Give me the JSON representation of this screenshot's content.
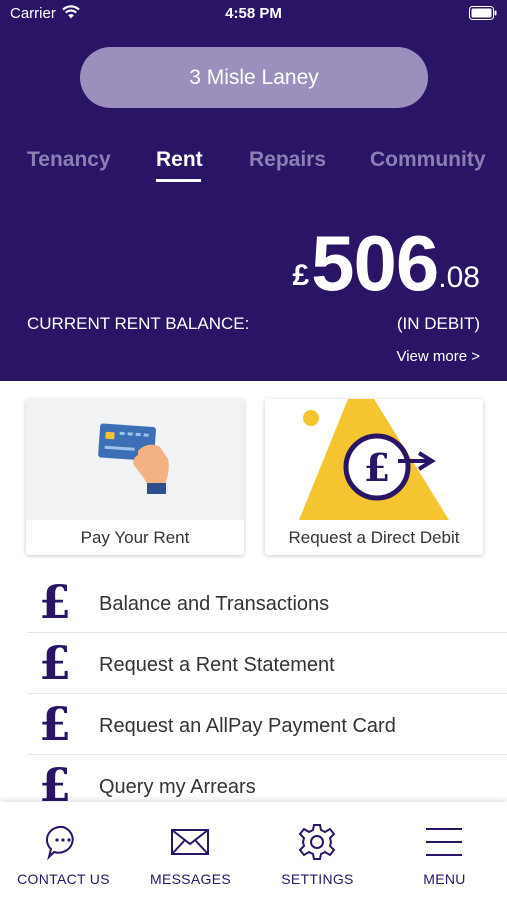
{
  "status_bar": {
    "carrier": "Carrier",
    "time": "4:58 PM"
  },
  "property": {
    "address": "3 Misle Laney"
  },
  "tabs": [
    {
      "label": "Tenancy",
      "active": false
    },
    {
      "label": "Rent",
      "active": true
    },
    {
      "label": "Repairs",
      "active": false
    },
    {
      "label": "Community",
      "active": false
    }
  ],
  "balance": {
    "currency": "£",
    "amount_main": "506",
    "amount_pence": ".08",
    "label": "CURRENT RENT BALANCE:",
    "status": "(IN DEBIT)",
    "view_more": "View more >"
  },
  "cards": [
    {
      "label": "Pay Your Rent",
      "icon": "card-payment-icon"
    },
    {
      "label": "Request a Direct Debit",
      "icon": "direct-debit-icon"
    }
  ],
  "list": [
    {
      "label": "Balance and Transactions",
      "icon": "pound-icon"
    },
    {
      "label": "Request a Rent Statement",
      "icon": "pound-icon"
    },
    {
      "label": "Request an AllPay Payment Card",
      "icon": "pound-icon"
    },
    {
      "label": "Query my Arrears",
      "icon": "pound-icon"
    }
  ],
  "bottom_nav": [
    {
      "label": "CONTACT US",
      "icon": "chat-bubble-icon"
    },
    {
      "label": "MESSAGES",
      "icon": "envelope-icon"
    },
    {
      "label": "SETTINGS",
      "icon": "gear-icon"
    },
    {
      "label": "MENU",
      "icon": "hamburger-icon"
    }
  ],
  "colors": {
    "brand": "#2a1466",
    "pill": "#9b8fbd",
    "tab_inactive": "#8b7fb4",
    "accent_yellow": "#f5c531"
  }
}
